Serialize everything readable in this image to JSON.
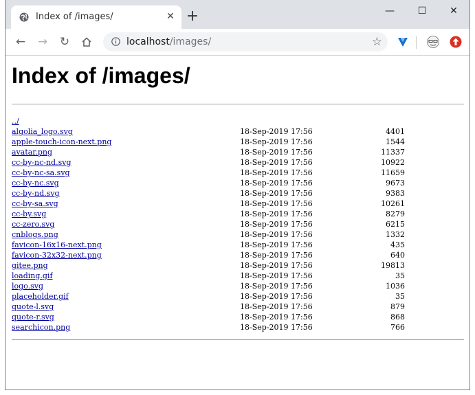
{
  "browser": {
    "tab_title": "Index of /images/",
    "tab_close_glyph": "✕",
    "new_tab_glyph": "+",
    "window_controls": {
      "minimize": "—",
      "maximize": "☐",
      "close": "✕"
    },
    "url_host": "localhost",
    "url_path": "/images/",
    "icons": [
      "back-arrow-icon",
      "forward-arrow-icon",
      "reload-icon",
      "home-icon",
      "info-icon",
      "star-icon",
      "extension-v-icon",
      "profile-avatar-icon",
      "update-arrow-icon"
    ]
  },
  "page": {
    "heading": "Index of /images/",
    "parent_link": "../",
    "entries": [
      {
        "name": "algolia_logo.svg",
        "date": "18-Sep-2019 17:56",
        "size": "4401"
      },
      {
        "name": "apple-touch-icon-next.png",
        "date": "18-Sep-2019 17:56",
        "size": "1544"
      },
      {
        "name": "avatar.png",
        "date": "18-Sep-2019 17:56",
        "size": "11337"
      },
      {
        "name": "cc-by-nc-nd.svg",
        "date": "18-Sep-2019 17:56",
        "size": "10922"
      },
      {
        "name": "cc-by-nc-sa.svg",
        "date": "18-Sep-2019 17:56",
        "size": "11659"
      },
      {
        "name": "cc-by-nc.svg",
        "date": "18-Sep-2019 17:56",
        "size": "9673"
      },
      {
        "name": "cc-by-nd.svg",
        "date": "18-Sep-2019 17:56",
        "size": "9383"
      },
      {
        "name": "cc-by-sa.svg",
        "date": "18-Sep-2019 17:56",
        "size": "10261"
      },
      {
        "name": "cc-by.svg",
        "date": "18-Sep-2019 17:56",
        "size": "8279"
      },
      {
        "name": "cc-zero.svg",
        "date": "18-Sep-2019 17:56",
        "size": "6215"
      },
      {
        "name": "cnblogs.png",
        "date": "18-Sep-2019 17:56",
        "size": "1332"
      },
      {
        "name": "favicon-16x16-next.png",
        "date": "18-Sep-2019 17:56",
        "size": "435"
      },
      {
        "name": "favicon-32x32-next.png",
        "date": "18-Sep-2019 17:56",
        "size": "640"
      },
      {
        "name": "gitee.png",
        "date": "18-Sep-2019 17:56",
        "size": "19813"
      },
      {
        "name": "loading.gif",
        "date": "18-Sep-2019 17:56",
        "size": "35"
      },
      {
        "name": "logo.svg",
        "date": "18-Sep-2019 17:56",
        "size": "1036"
      },
      {
        "name": "placeholder.gif",
        "date": "18-Sep-2019 17:56",
        "size": "35"
      },
      {
        "name": "quote-l.svg",
        "date": "18-Sep-2019 17:56",
        "size": "879"
      },
      {
        "name": "quote-r.svg",
        "date": "18-Sep-2019 17:56",
        "size": "868"
      },
      {
        "name": "searchicon.png",
        "date": "18-Sep-2019 17:56",
        "size": "766"
      }
    ]
  },
  "colors": {
    "tabstrip_bg": "#dee1e6",
    "link": "#00009c",
    "window_border": "#3c8fd0"
  }
}
